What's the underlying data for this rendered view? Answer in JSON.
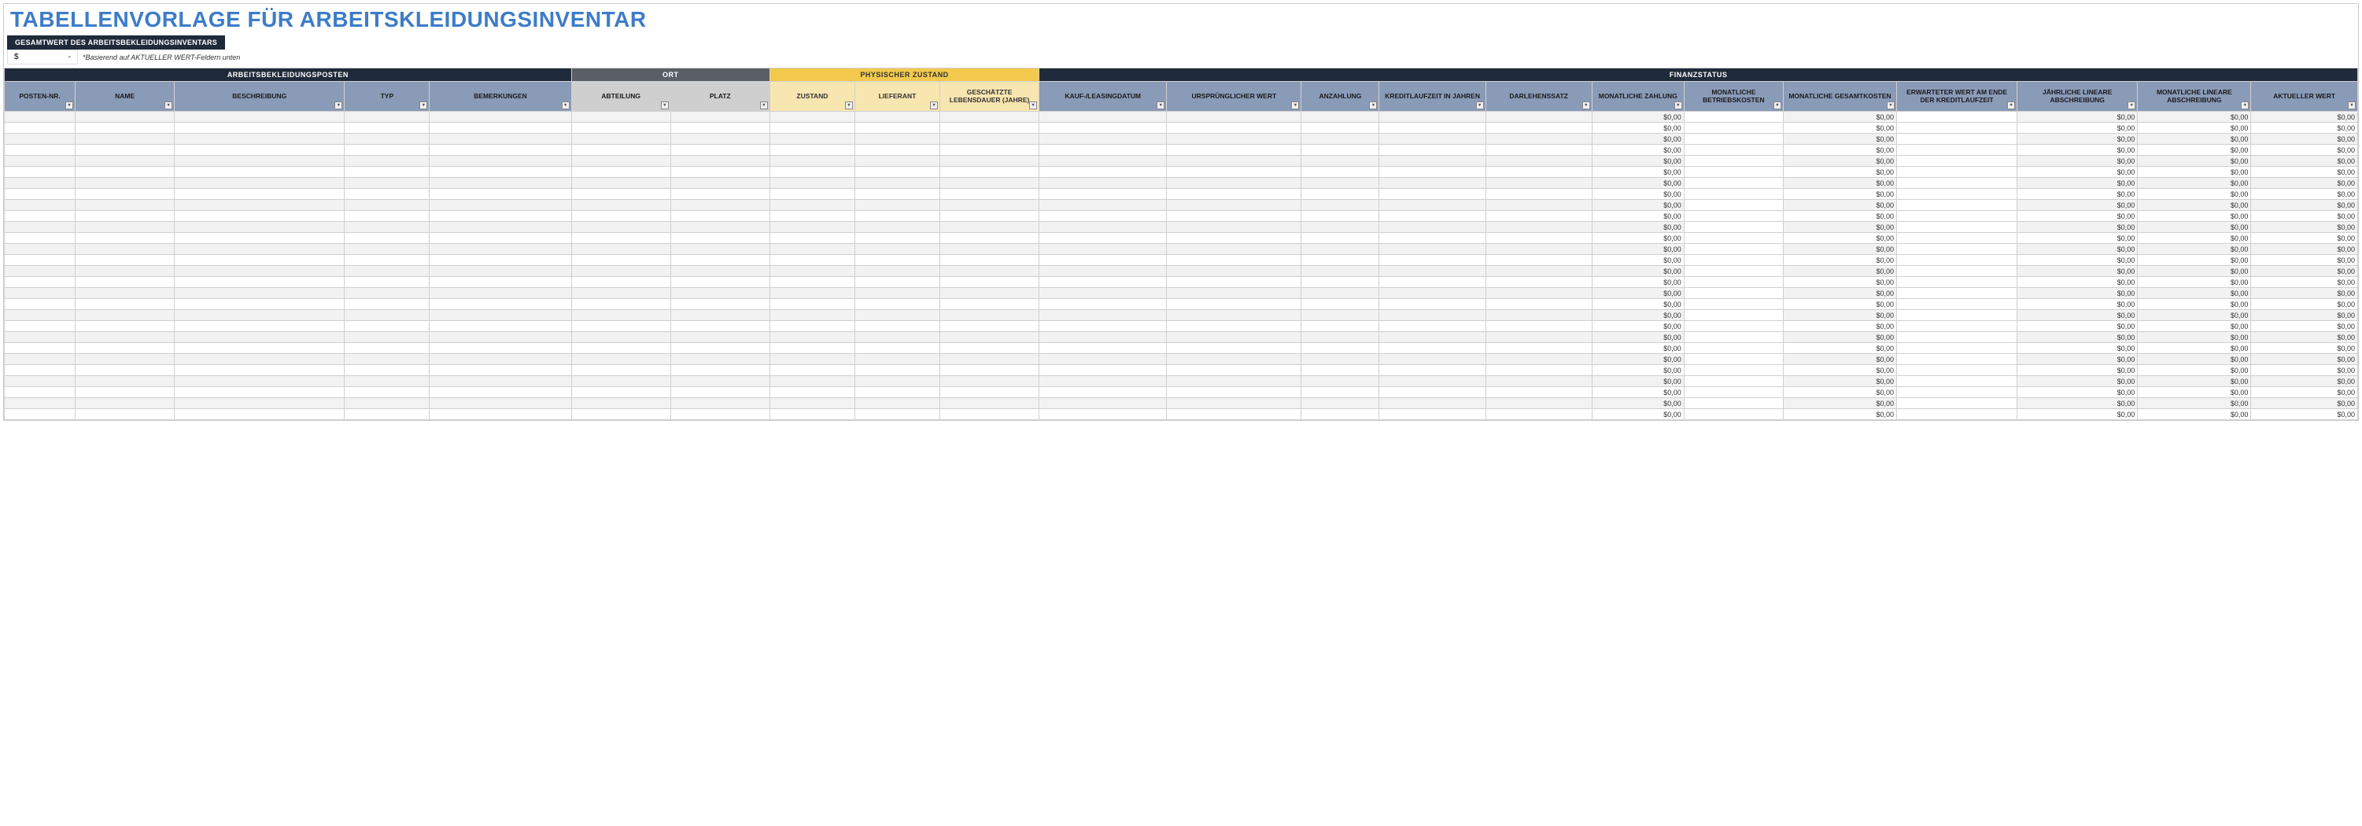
{
  "title": "TABELLENVORLAGE FÜR ARBEITSKLEIDUNGSINVENTAR",
  "summary": {
    "header": "GESAMTWERT DES ARBEITSBEKLEIDUNGSINVENTARS",
    "currency": "$",
    "value": "-",
    "note": "*Basierend auf AKTUELLER WERT-Feldern unten"
  },
  "groups": {
    "item": "ARBEITSBEKLEIDUNGSPOSTEN",
    "location": "ORT",
    "condition": "PHYSISCHER ZUSTAND",
    "finance": "FINANZSTATUS"
  },
  "columns": {
    "posten": "POSTEN-NR.",
    "name": "NAME",
    "beschreibung": "BESCHREIBUNG",
    "typ": "TYP",
    "bemerkungen": "BEMERKUNGEN",
    "abteilung": "ABTEILUNG",
    "platz": "PLATZ",
    "zustand": "ZUSTAND",
    "lieferant": "LIEFERANT",
    "lebensdauer": "GESCHÄTZTE LEBENSDAUER (JAHRE)",
    "kaufdatum": "KAUF-/LEASINGDATUM",
    "ursprwert": "URSPRÜNGLICHER WERT",
    "anzahlung": "ANZAHLUNG",
    "kreditlaufzeit": "KREDITLAUFZEIT IN JAHREN",
    "darlehenssatz": "DARLEHENSSATZ",
    "mzahlung": "MONATLICHE ZAHLUNG",
    "mbetrieb": "MONATLICHE BETRIEBSKOSTEN",
    "mgesamt": "MONATLICHE GESAMTKOSTEN",
    "erwartet": "ERWARTETER WERT AM ENDE DER KREDITLAUFZEIT",
    "jlinear": "JÄHRLICHE LINEARE ABSCHREIBUNG",
    "mlinear": "MONATLICHE LINEARE ABSCHREIBUNG",
    "aktuell": "AKTUELLER WERT"
  },
  "zero": "$0,00",
  "row_count": 28
}
